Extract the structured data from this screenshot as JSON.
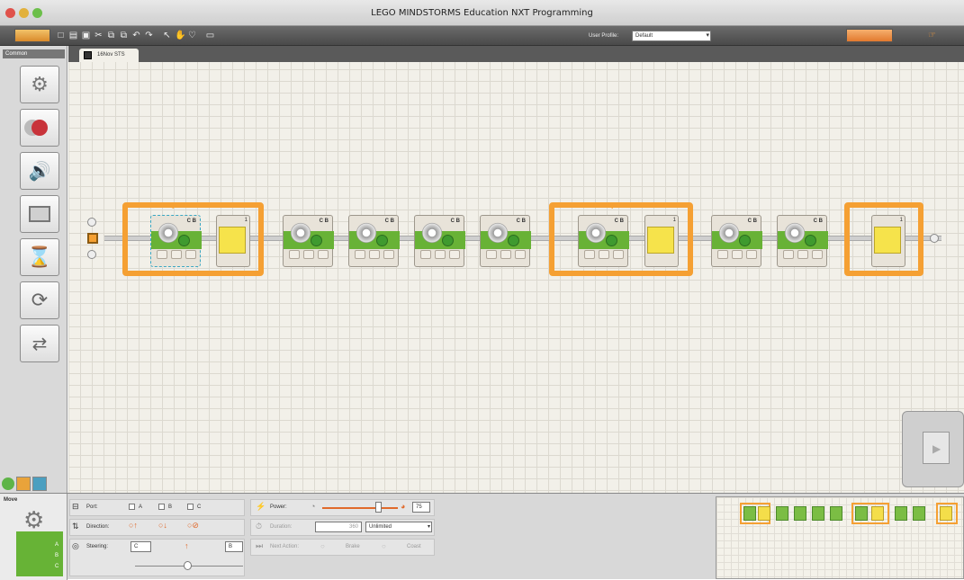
{
  "window": {
    "title": "LEGO MINDSTORMS Education NXT Programming"
  },
  "toolbar": {
    "user_profile_label": "User Profile:",
    "user_profile_value": "Default"
  },
  "palette": {
    "title": "Common",
    "items": [
      {
        "name": "move-block",
        "icon": "gears-icon"
      },
      {
        "name": "record-play-block",
        "icon": "record-play-icon"
      },
      {
        "name": "sound-block",
        "icon": "speaker-icon"
      },
      {
        "name": "display-block",
        "icon": "display-icon"
      },
      {
        "name": "wait-block",
        "icon": "hourglass-icon"
      },
      {
        "name": "loop-block",
        "icon": "loop-icon"
      },
      {
        "name": "switch-block",
        "icon": "switch-icon"
      }
    ]
  },
  "tab": {
    "label": "16Nov STS"
  },
  "blocks": {
    "move_label": "C B",
    "loop_counter": "1"
  },
  "config": {
    "block_name": "Move",
    "port_label": "Port:",
    "port_a": "A",
    "port_b": "B",
    "port_c": "C",
    "direction_label": "Direction:",
    "steering_label": "Steering:",
    "steering_left": "C",
    "steering_right": "B",
    "power_label": "Power:",
    "power_value": "75",
    "power_level": 0.75,
    "duration_label": "Duration:",
    "duration_value": "360",
    "duration_unit": "Unlimited",
    "next_action_label": "Next Action:",
    "brake_label": "Brake",
    "coast_label": "Coast"
  },
  "colors": {
    "accent": "#f5a033",
    "move_green": "#68b236",
    "wait_yellow": "#f6e34b"
  }
}
